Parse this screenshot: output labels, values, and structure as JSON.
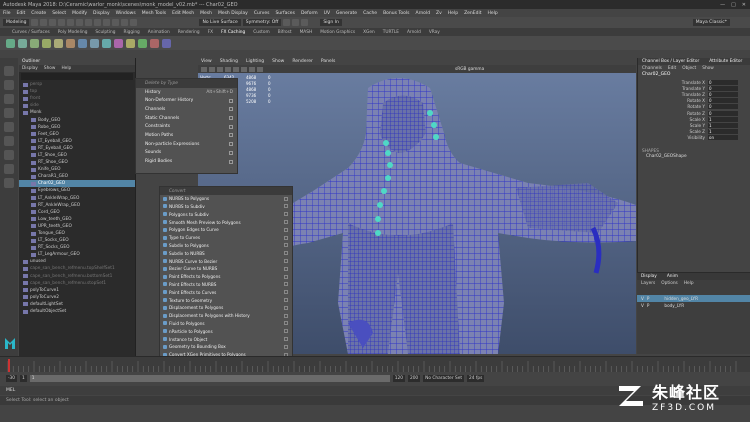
{
  "window": {
    "title": "Autodesk Maya 2018: D:\\Ceramic\\warlor_monk\\scenes\\monk_model_v02.mb* --- Char02_GEO"
  },
  "menubar": [
    "File",
    "Edit",
    "Create",
    "Select",
    "Modify",
    "Display",
    "Windows",
    "Mesh Tools",
    "Edit Mesh",
    "Mesh",
    "Mesh Display",
    "Curves",
    "Surfaces",
    "Deform",
    "UV",
    "Generate",
    "Cache",
    "Bonus Tools",
    "Arnold",
    "Zv",
    "Help",
    "ZenEdit",
    "Help"
  ],
  "status": {
    "mode": "Modeling",
    "live": "No Live Surface",
    "symmetry": "Symmetry: Off",
    "signin": "Sign In",
    "workspace": "Maya Classic*"
  },
  "shelf_tabs": [
    "Curves / Surfaces",
    "Poly Modeling",
    "Sculpting",
    "Rigging",
    "Animation",
    "Rendering",
    "FX",
    "FX Caching",
    "Custom",
    "Bifrost",
    "MASH",
    "Motion Graphics",
    "XGen",
    "TURTLE",
    "Arnold",
    "VRay"
  ],
  "outliner": {
    "title": "Outliner",
    "menus": [
      "Display",
      "Show",
      "Help"
    ],
    "items": [
      {
        "label": "persp",
        "dim": true
      },
      {
        "label": "top",
        "dim": true
      },
      {
        "label": "front",
        "dim": true
      },
      {
        "label": "side",
        "dim": true
      },
      {
        "label": "Monk",
        "dim": false,
        "sel": false
      },
      {
        "label": "Body_GEO"
      },
      {
        "label": "Robe_GEO"
      },
      {
        "label": "Feet_GEO"
      },
      {
        "label": "LT_Eyeball_GEO"
      },
      {
        "label": "RT_Eyeball_GEO"
      },
      {
        "label": "LT_Shoe_GEO"
      },
      {
        "label": "RT_Shoe_GEO"
      },
      {
        "label": "Knife_GEO"
      },
      {
        "label": "CharaR1_GEO"
      },
      {
        "label": "Char02_GEO",
        "sel": true
      },
      {
        "label": "Eyebrows_GEO"
      },
      {
        "label": "LT_AnkleWrap_GEO"
      },
      {
        "label": "RT_AnkleWrap_GEO"
      },
      {
        "label": "Cord_GEO"
      },
      {
        "label": "Low_teeth_GEO"
      },
      {
        "label": "UPR_teeth_GEO"
      },
      {
        "label": "Tongue_GEO"
      },
      {
        "label": "LT_Socks_GEO"
      },
      {
        "label": "RT_Socks_GEO"
      },
      {
        "label": "LT_LegArmour_GEO"
      },
      {
        "label": "unused"
      },
      {
        "label": "cape_san_bench_refmenu.topShelfSet1",
        "dim": true
      },
      {
        "label": "cape_san_bench_refmenu.bottomSet1",
        "dim": true
      },
      {
        "label": "cape_san_bench_refmenu.stopSet1",
        "dim": true
      },
      {
        "label": "polyToCurve1"
      },
      {
        "label": "polyToCurve2"
      },
      {
        "label": "defaultLightSet"
      },
      {
        "label": "defaultObjectSet"
      }
    ]
  },
  "viewport": {
    "menus": [
      "View",
      "Shading",
      "Lighting",
      "Show",
      "Renderer",
      "Panels"
    ],
    "camera": "persp",
    "colorspace": "sRGB gamma",
    "hud": [
      [
        "Verts:",
        "6342",
        "4868",
        "0"
      ],
      [
        "Edges:",
        "12458",
        "9676",
        "0"
      ],
      [
        "Faces:",
        "6150",
        "4868",
        "0"
      ],
      [
        "Tris:",
        "12300",
        "9736",
        "0"
      ],
      [
        "UVs:",
        "6668",
        "5208",
        "0"
      ]
    ]
  },
  "context_menu": {
    "search": "Delete by Type",
    "items": [
      {
        "label": "History",
        "shortcut": "Alt+Shift+D"
      },
      {
        "label": "Non-Deformer History"
      },
      {
        "label": "Channels"
      },
      {
        "label": "Static Channels"
      },
      {
        "label": "Constraints"
      },
      {
        "label": "Motion Paths"
      },
      {
        "label": "Non-particle Expressions"
      },
      {
        "label": "Sounds"
      },
      {
        "label": "Rigid Bodies"
      }
    ]
  },
  "sub_menu": {
    "search": "Convert",
    "items": [
      {
        "label": "NURBS to Polygons"
      },
      {
        "label": "NURBS to Subdiv"
      },
      {
        "label": "Polygons to Subdiv"
      },
      {
        "label": "Smooth Mesh Preview to Polygons"
      },
      {
        "label": "Polygon Edges to Curve"
      },
      {
        "label": "Type to Curves"
      },
      {
        "label": "Subdiv to Polygons"
      },
      {
        "label": "Subdiv to NURBS"
      },
      {
        "label": "NURBS Curve to Bezier"
      },
      {
        "label": "Bezier Curve to NURBS"
      },
      {
        "label": "Paint Effects to Polygons"
      },
      {
        "label": "Paint Effects to NURBS"
      },
      {
        "label": "Paint Effects to Curves"
      },
      {
        "label": "Texture to Geometry"
      },
      {
        "label": "Displacement to Polygons"
      },
      {
        "label": "Displacement to Polygons with History"
      },
      {
        "label": "Fluid to Polygons"
      },
      {
        "label": "nParticle to Polygons"
      },
      {
        "label": "Instance to Object"
      },
      {
        "label": "Geometry to Bounding Box"
      },
      {
        "label": "Convert XGen Primitives to Polygons"
      }
    ]
  },
  "channel_box": {
    "tabs": [
      "Channel Box / Layer Editor",
      "Attribute Editor"
    ],
    "menus": [
      "Channels",
      "Edit",
      "Object",
      "Show"
    ],
    "object": "Char02_GEO",
    "attrs": [
      [
        "Translate X",
        "0"
      ],
      [
        "Translate Y",
        "0"
      ],
      [
        "Translate Z",
        "0"
      ],
      [
        "Rotate X",
        "0"
      ],
      [
        "Rotate Y",
        "0"
      ],
      [
        "Rotate Z",
        "0"
      ],
      [
        "Scale X",
        "1"
      ],
      [
        "Scale Y",
        "1"
      ],
      [
        "Scale Z",
        "1"
      ],
      [
        "Visibility",
        "on"
      ]
    ],
    "shapes_label": "SHAPES",
    "shape": "Char02_GEOShape"
  },
  "layers": {
    "tabs": [
      "Display",
      "Anim"
    ],
    "menus": [
      "Layers",
      "Options",
      "Help"
    ],
    "rows": [
      [
        "V",
        "P",
        "hidden_geo_LYR"
      ],
      [
        "V",
        "P",
        "body_LYR"
      ]
    ]
  },
  "timeline": {
    "start": "1",
    "end": "120",
    "range_start": "-30",
    "range_end": "120",
    "range_end2": "200",
    "current": "1",
    "character": "No Character Set",
    "fps": "24 fps"
  },
  "mel": "MEL",
  "help": "Select Tool: select an object",
  "watermark": {
    "brand": "朱峰社区",
    "url": "ZF3D.COM"
  },
  "colors": {
    "accent": "#5285a6",
    "mesh": "#3a3ce0",
    "beads": "#4fd8c6"
  }
}
